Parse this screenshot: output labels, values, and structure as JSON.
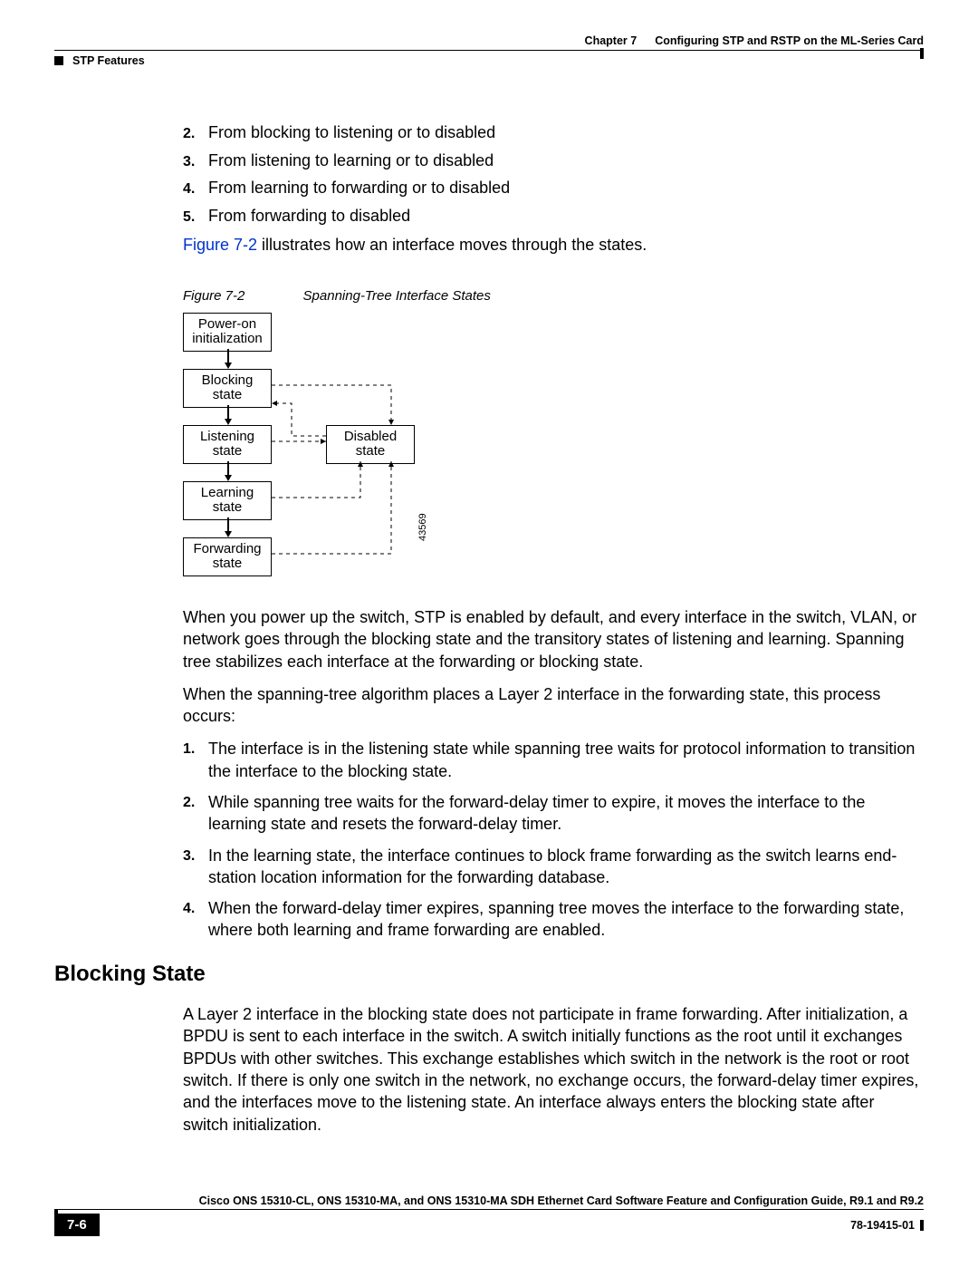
{
  "header": {
    "section": "STP Features",
    "chapter_label": "Chapter 7",
    "chapter_title": "Configuring STP and RSTP on the ML-Series Card"
  },
  "list1": {
    "items": [
      {
        "n": "2.",
        "text": "From blocking to listening or to disabled"
      },
      {
        "n": "3.",
        "text": "From listening to learning or to disabled"
      },
      {
        "n": "4.",
        "text": "From learning to forwarding or to disabled"
      },
      {
        "n": "5.",
        "text": "From forwarding to disabled"
      }
    ]
  },
  "figref_line": {
    "link": "Figure 7-2",
    "rest": " illustrates how an interface moves through the states."
  },
  "figure": {
    "label": "Figure 7-2",
    "title": "Spanning-Tree Interface States",
    "boxes": {
      "power": "Power-on\ninitialization",
      "blocking": "Blocking\nstate",
      "listening": "Listening\nstate",
      "learning": "Learning\nstate",
      "forwarding": "Forwarding\nstate",
      "disabled": "Disabled\nstate"
    },
    "diag_num": "43569"
  },
  "para1": "When you power up the switch, STP is enabled by default, and every interface in the switch, VLAN, or network goes through the blocking state and the transitory states of listening and learning. Spanning tree stabilizes each interface at the forwarding or blocking state.",
  "para2": "When the spanning-tree algorithm places a Layer 2 interface in the forwarding state, this process occurs:",
  "list2": {
    "items": [
      {
        "n": "1.",
        "text": "The interface is in the listening state while spanning tree waits for protocol information to transition the interface to the blocking state."
      },
      {
        "n": "2.",
        "text": "While spanning tree waits for the forward-delay timer to expire, it moves the interface to the learning state and resets the forward-delay timer."
      },
      {
        "n": "3.",
        "text": "In the learning state, the interface continues to block frame forwarding as the switch learns end-station location information for the forwarding database."
      },
      {
        "n": "4.",
        "text": "When the forward-delay timer expires, spanning tree moves the interface to the forwarding state, where both learning and frame forwarding are enabled."
      }
    ]
  },
  "section_head": "Blocking State",
  "para3": "A Layer 2 interface in the blocking state does not participate in frame forwarding. After initialization, a BPDU is sent to each interface in the switch. A switch initially functions as the root until it exchanges BPDUs with other switches. This exchange establishes which switch in the network is the root or root switch. If there is only one switch in the network, no exchange occurs, the forward-delay timer expires, and the interfaces move to the listening state. An interface always enters the blocking state after switch initialization.",
  "footer": {
    "title": "Cisco ONS 15310-CL, ONS 15310-MA, and ONS 15310-MA SDH Ethernet Card Software Feature and Configuration Guide, R9.1 and R9.2",
    "page": "7-6",
    "docnum": "78-19415-01"
  }
}
